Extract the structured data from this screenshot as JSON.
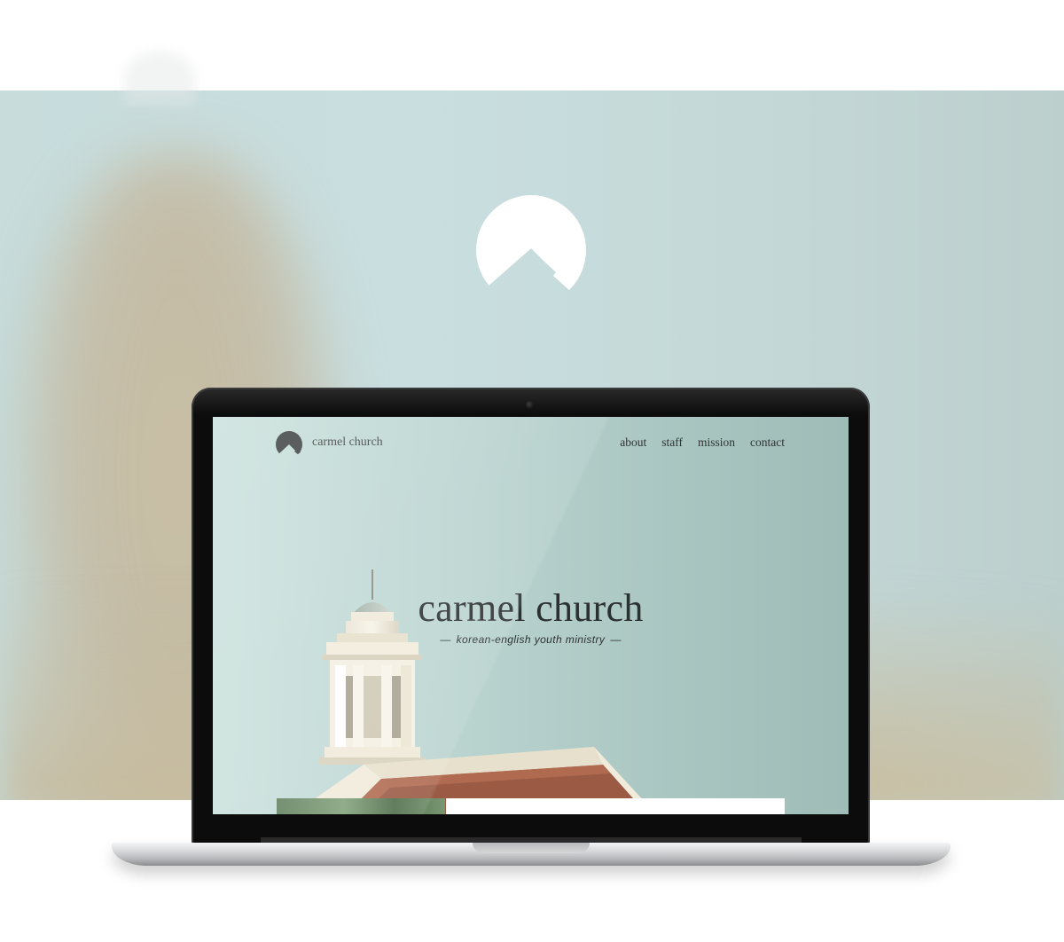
{
  "site": {
    "name": "carmel church",
    "nav": [
      "about",
      "staff",
      "mission",
      "contact"
    ],
    "hero_title": "carmel church",
    "hero_subtitle": "korean-english youth ministry",
    "dash": "—"
  },
  "colors": {
    "backdrop": "#c7dcdb",
    "screen_bg": "#b9d3cf",
    "text_dark": "#2b3030",
    "logo_white": "#ffffff",
    "logo_dark": "#3a3f3f"
  },
  "icons": {
    "brand_logo": "mountain-circle-icon",
    "site_logo": "mountain-circle-icon",
    "camera": "camera-icon"
  }
}
